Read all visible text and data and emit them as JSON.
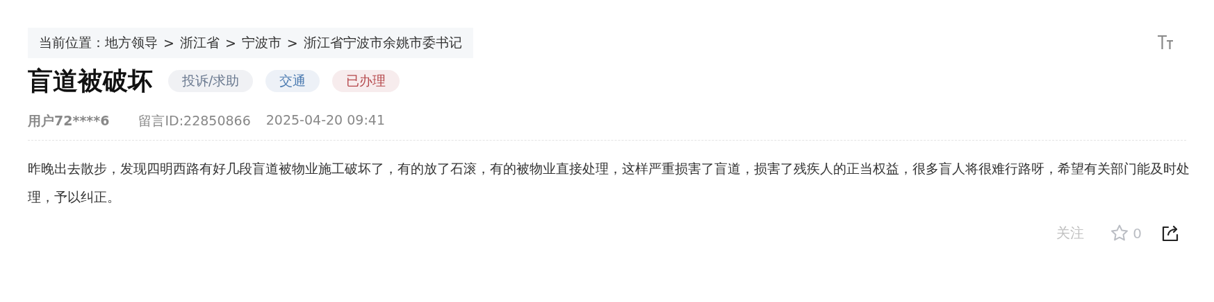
{
  "breadcrumb": {
    "label": "当前位置：",
    "items": [
      "地方领导",
      "浙江省",
      "宁波市",
      "浙江省宁波市余姚市委书记"
    ],
    "separator": ">"
  },
  "title": "盲道被破坏",
  "tags": [
    {
      "label": "投诉/求助",
      "color": "#6b7a90"
    },
    {
      "label": "交通",
      "color": "#4a7ab0"
    },
    {
      "label": "已办理",
      "color": "#b5474b"
    }
  ],
  "meta": {
    "user": "用户72****6",
    "message_id": "留言ID:22850866",
    "time": "2025-04-20 09:41"
  },
  "body": "昨晚出去散步，发现四明西路有好几段盲道被物业施工破坏了，有的放了石滚，有的被物业直接处理，这样严重损害了盲道，损害了残疾人的正当权益，很多盲人将很难行路呀，希望有关部门能及时处理，予以纠正。",
  "actions": {
    "follow": "关注",
    "likes": "0"
  }
}
